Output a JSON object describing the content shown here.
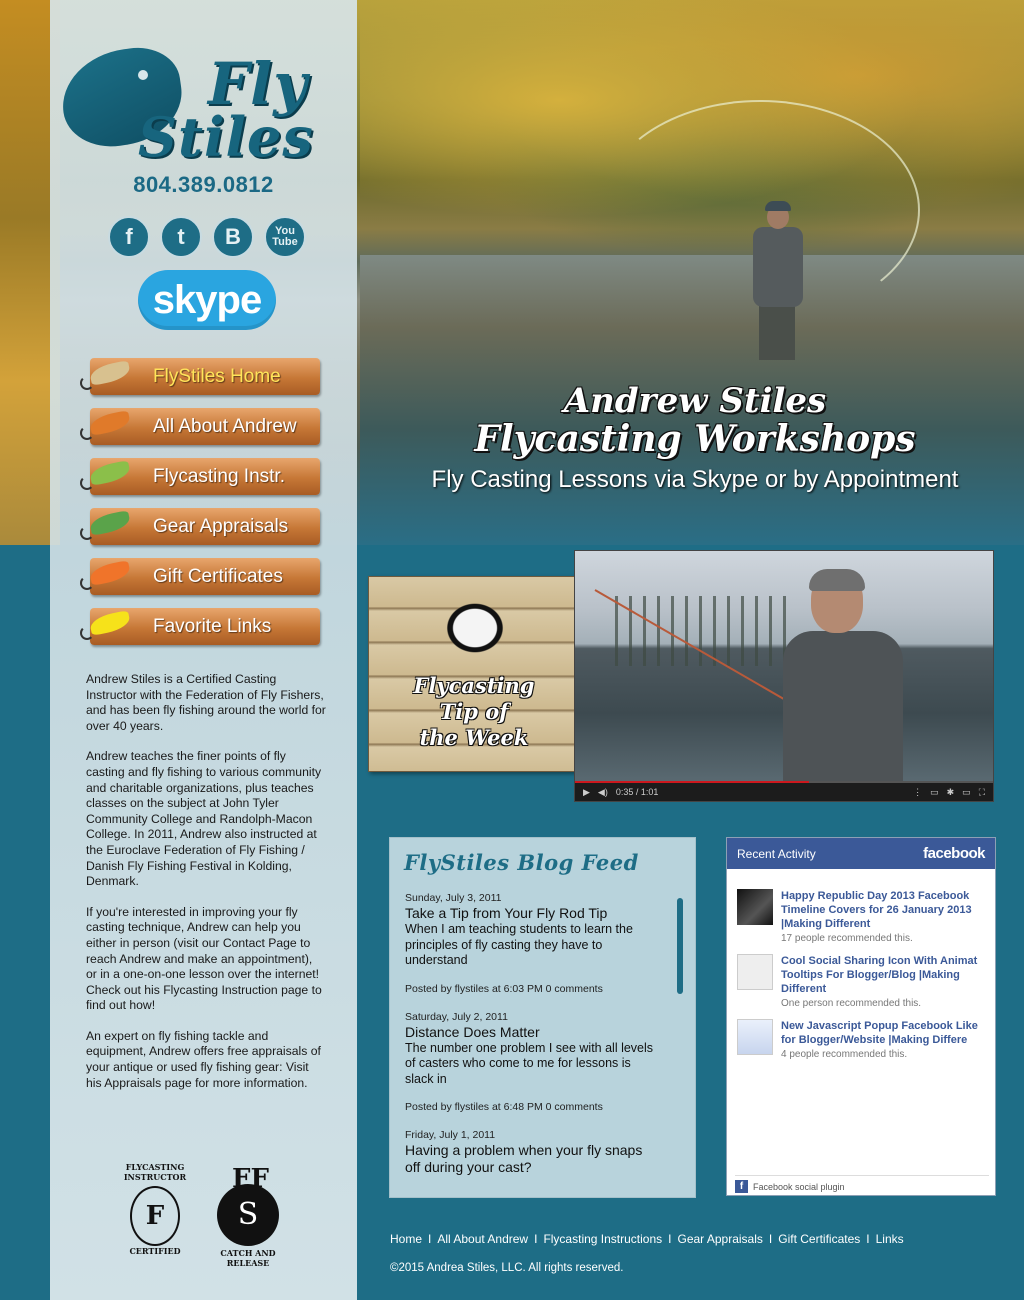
{
  "brand": {
    "logo_line1": "Fly",
    "logo_line2": "Stiles"
  },
  "phone": "804.389.0812",
  "social": [
    {
      "name": "facebook-icon",
      "glyph": "f"
    },
    {
      "name": "twitter-icon",
      "glyph": "t"
    },
    {
      "name": "blogger-icon",
      "glyph": "B"
    },
    {
      "name": "youtube-icon",
      "glyph1": "You",
      "glyph2": "Tube"
    }
  ],
  "skype_label": "skype",
  "nav": [
    {
      "label": "FlyStiles Home",
      "active": true,
      "wing": "#d8c18f"
    },
    {
      "label": "All About Andrew",
      "active": false,
      "wing": "#e07a2a"
    },
    {
      "label": "Flycasting Instr.",
      "active": false,
      "wing": "#8bbf4a"
    },
    {
      "label": "Gear Appraisals",
      "active": false,
      "wing": "#5aa34a"
    },
    {
      "label": "Gift Certificates",
      "active": false,
      "wing": "#f0742a"
    },
    {
      "label": "Favorite Links",
      "active": false,
      "wing": "#f6e21a"
    }
  ],
  "hero": {
    "title_line1": "Andrew Stiles",
    "title_line2": "Flycasting Workshops",
    "subtitle": "Fly Casting Lessons via Skype or by Appointment"
  },
  "about": [
    "Andrew Stiles is a Certified Casting Instructor with the Federation of Fly Fishers, and has been fly fishing around the world for over 40 years.",
    "Andrew teaches the finer points of fly casting and fly fishing to various community and charitable organizations, plus teaches classes on the subject at John Tyler Community College and Randolph-Macon College. In 2011, Andrew also instructed at the Euroclave Federation of Fly Fishing / Danish Fly Fishing Festival in Kolding, Denmark.",
    "If you're interested in improving your fly casting technique, Andrew can help you either in person (visit our Contact Page to reach Andrew and make an appointment), or in a one-on-one lesson over the internet! Check out his Flycasting Instruction page to find out how!",
    "An expert on fly fishing tackle and equipment, Andrew offers free appraisals of your antique or used fly fishing gear: Visit his Appraisals page for more information."
  ],
  "badges": {
    "b1_top": "FLYCASTING INSTRUCTOR",
    "b1_mark": "F",
    "b1_bottom": "CERTIFIED",
    "b2_top": "FF",
    "b2_mark": "S",
    "b2_bottom": "CATCH AND RELEASE"
  },
  "tip": {
    "line1": "Flycasting",
    "line2": "Tip of",
    "line3": "the Week"
  },
  "video": {
    "time": "0:35 / 1:01",
    "progress": 0.56
  },
  "blog": {
    "title": "FlyStiles Blog Feed",
    "posts": [
      {
        "date": "Sunday, July 3, 2011",
        "title": "Take a Tip from Your Fly Rod Tip",
        "excerpt": "When I am teaching students to learn the principles of fly casting they have to understand",
        "meta": "Posted by flystiles at 6:03 PM 0 comments"
      },
      {
        "date": "Saturday, July 2, 2011",
        "title": "Distance Does Matter",
        "excerpt": "The number one problem I see with all levels of casters who come to me for lessons is slack in",
        "meta": "Posted by flystiles at 6:48 PM 0 comments"
      },
      {
        "date": "Friday, July 1, 2011",
        "title": "Having a problem when your fly snaps off during your cast?",
        "excerpt": "",
        "meta": ""
      }
    ]
  },
  "facebook": {
    "header": "Recent Activity",
    "brand": "facebook",
    "items": [
      {
        "title1": "Happy Republic Day 2013 Facebook",
        "title2": "Timeline Covers for 26 January 2013",
        "title3": "|Making Different",
        "rec": "17 people recommended this."
      },
      {
        "title1": "Cool Social Sharing Icon With Animat",
        "title2": "Tooltips For Blogger/Blog |Making",
        "title3": "Different",
        "rec": "One person recommended this."
      },
      {
        "title1": "New Javascript Popup Facebook Like",
        "title2": "for Blogger/Website |Making Differe",
        "title3": "",
        "rec": "4 people recommended this."
      }
    ],
    "plugin": "Facebook social plugin"
  },
  "footer": {
    "links": [
      "Home",
      "All About Andrew",
      "Flycasting Instructions",
      "Gear Appraisals",
      "Gift Certificates",
      "Links"
    ],
    "separator": "I",
    "copyright": "©2015 Andrea Stiles, LLC. All rights reserved."
  }
}
